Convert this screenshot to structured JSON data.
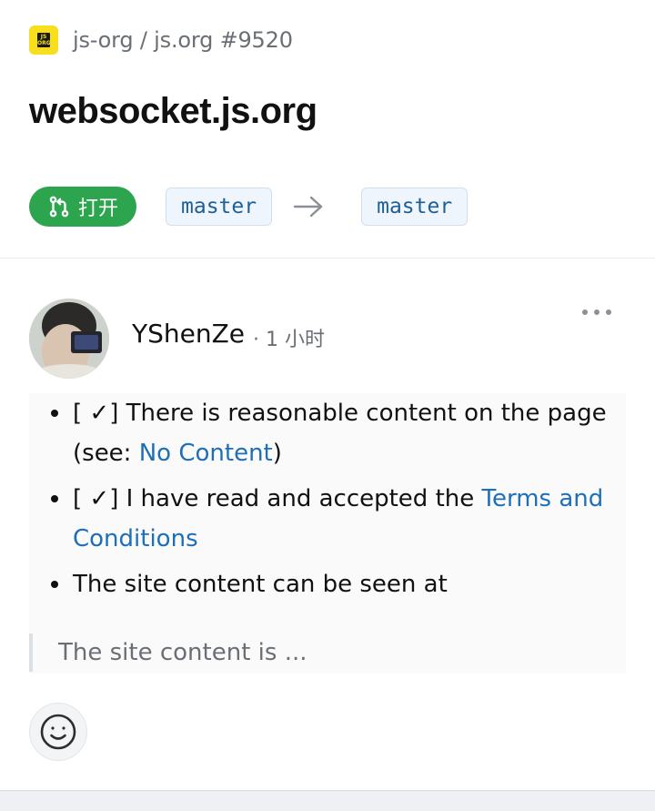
{
  "breadcrumb": {
    "text": "js-org / js.org #9520",
    "logo_text": "JS ORG"
  },
  "page": {
    "title": "websocket.js.org"
  },
  "status": {
    "label": "打开",
    "color": "#2da44e",
    "base_branch": "master",
    "head_branch": "master"
  },
  "comment": {
    "author": "YShenZe",
    "time": "· 1 小时",
    "items": [
      {
        "prefix": "[ ✓] There is reasonable content on the page (see: ",
        "link": "No Content",
        "suffix": ")"
      },
      {
        "prefix": "[ ✓] I have read and accepted the ",
        "link": "Terms and Conditions",
        "suffix": ""
      },
      {
        "prefix": "The site content can be seen at",
        "link": "",
        "suffix": ""
      }
    ],
    "quote": "The site content is ..."
  },
  "icons": {
    "more": "more-horizontal-icon",
    "emoji": "smiley-icon",
    "pr": "pull-request-icon",
    "arrow": "arrow-right-icon"
  },
  "colors": {
    "link": "#1f6fb8",
    "branch_bg": "#eef5fc"
  }
}
